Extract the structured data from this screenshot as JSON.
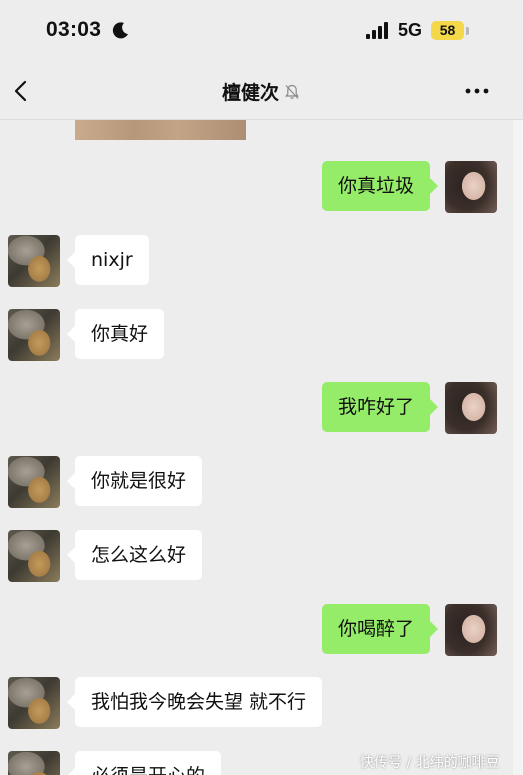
{
  "status_bar": {
    "time": "03:03",
    "network": "5G",
    "battery": "58",
    "icons": [
      "moon-icon",
      "signal-icon",
      "battery-icon"
    ],
    "battery_color": "#f5d84a"
  },
  "nav": {
    "title": "檀健次",
    "back_icon": "chevron-left-icon",
    "mute_icon": "bell-slash-icon",
    "more_icon": "more-dots-icon"
  },
  "colors": {
    "background": "#ededed",
    "self_bubble": "#95ec69",
    "other_bubble": "#ffffff"
  },
  "messages": [
    {
      "sender": "self",
      "text": "你真垃圾"
    },
    {
      "sender": "other",
      "text": "nixjr"
    },
    {
      "sender": "other",
      "text": "你真好"
    },
    {
      "sender": "self",
      "text": "我咋好了"
    },
    {
      "sender": "other",
      "text": "你就是很好"
    },
    {
      "sender": "other",
      "text": "怎么这么好"
    },
    {
      "sender": "self",
      "text": "你喝醉了"
    },
    {
      "sender": "other",
      "text": "我怕我今晚会失望 就不行"
    },
    {
      "sender": "other",
      "text": "必须是开心的"
    }
  ],
  "watermark": "快传号 / 北纬的咖啡豆"
}
